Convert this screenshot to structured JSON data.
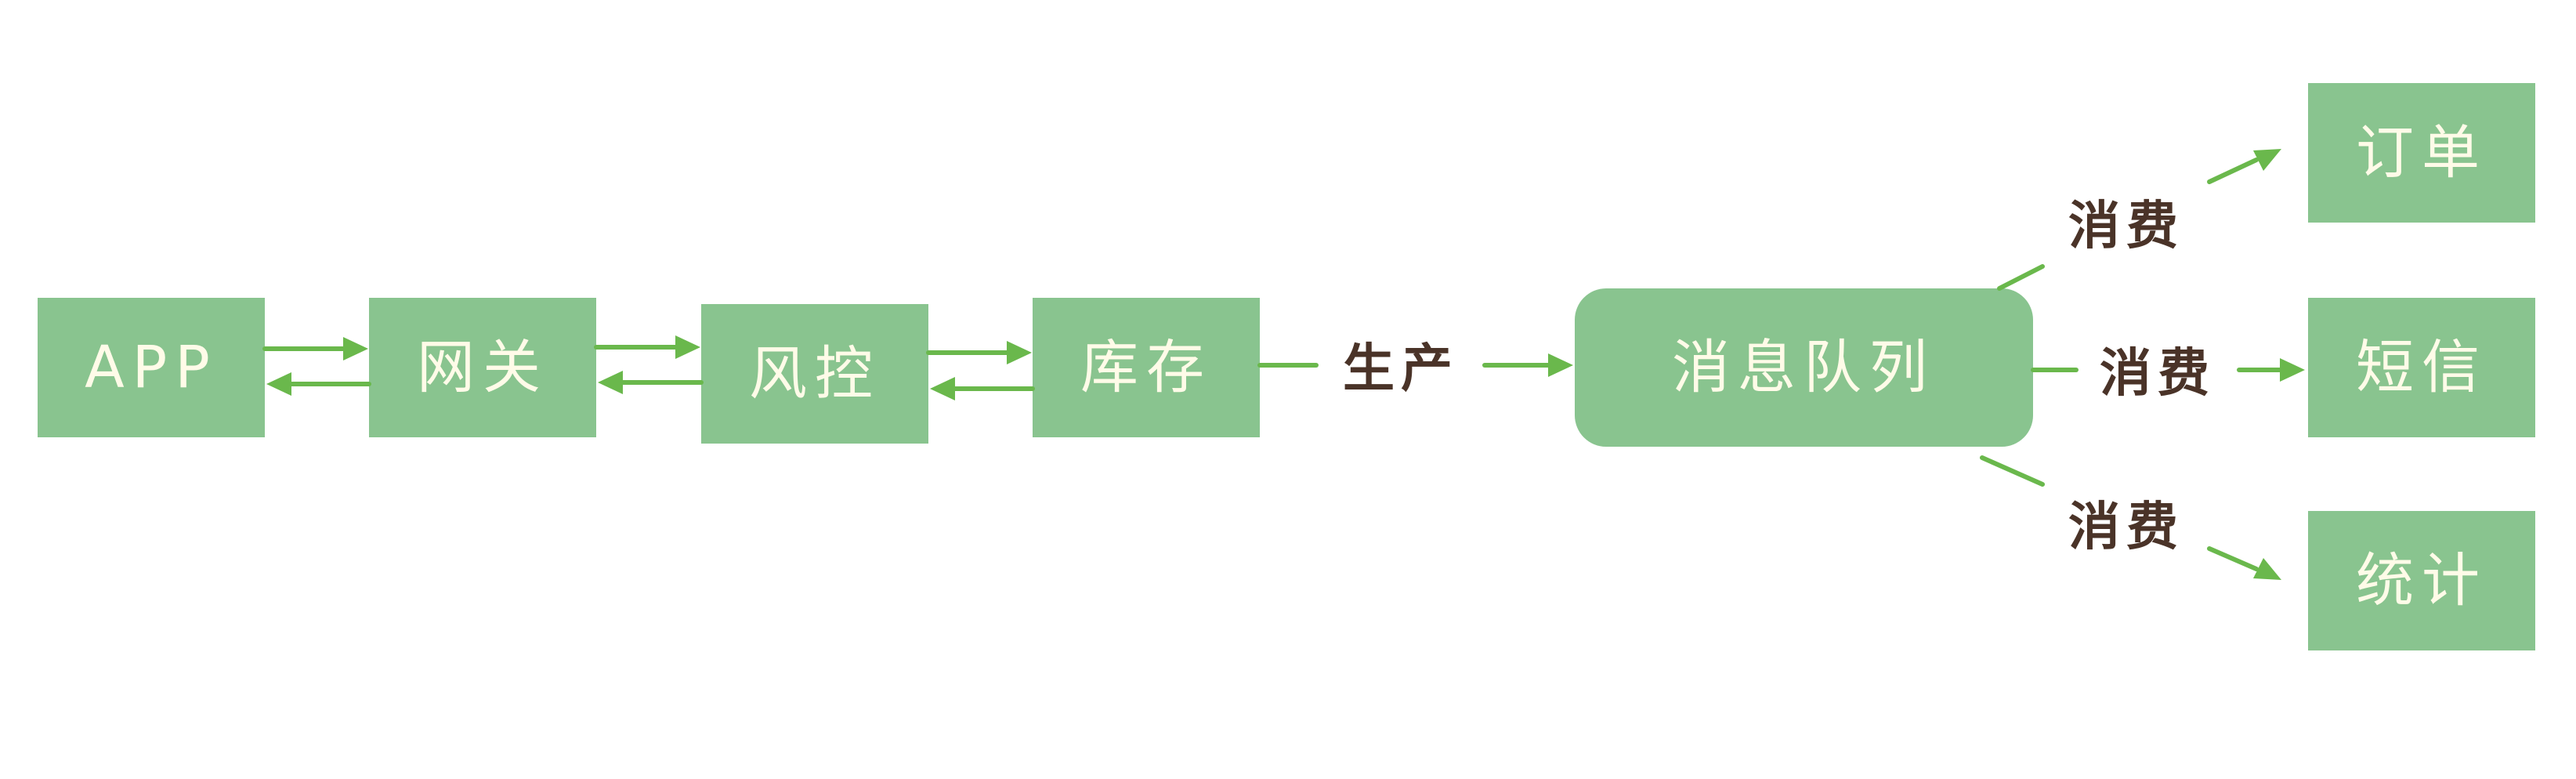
{
  "nodes": {
    "app": "APP",
    "gateway": "网关",
    "risk_control": "风控",
    "inventory": "库存",
    "message_queue": "消息队列",
    "order": "订单",
    "sms": "短信",
    "statistics": "统计"
  },
  "edges": {
    "produce": "生产",
    "consume_order": "消费",
    "consume_sms": "消费",
    "consume_stats": "消费"
  },
  "colors": {
    "node_fill": "#89c48f",
    "node_text": "#fffbe8",
    "arrow": "#6ab84c",
    "edge_label": "#4a3328"
  }
}
